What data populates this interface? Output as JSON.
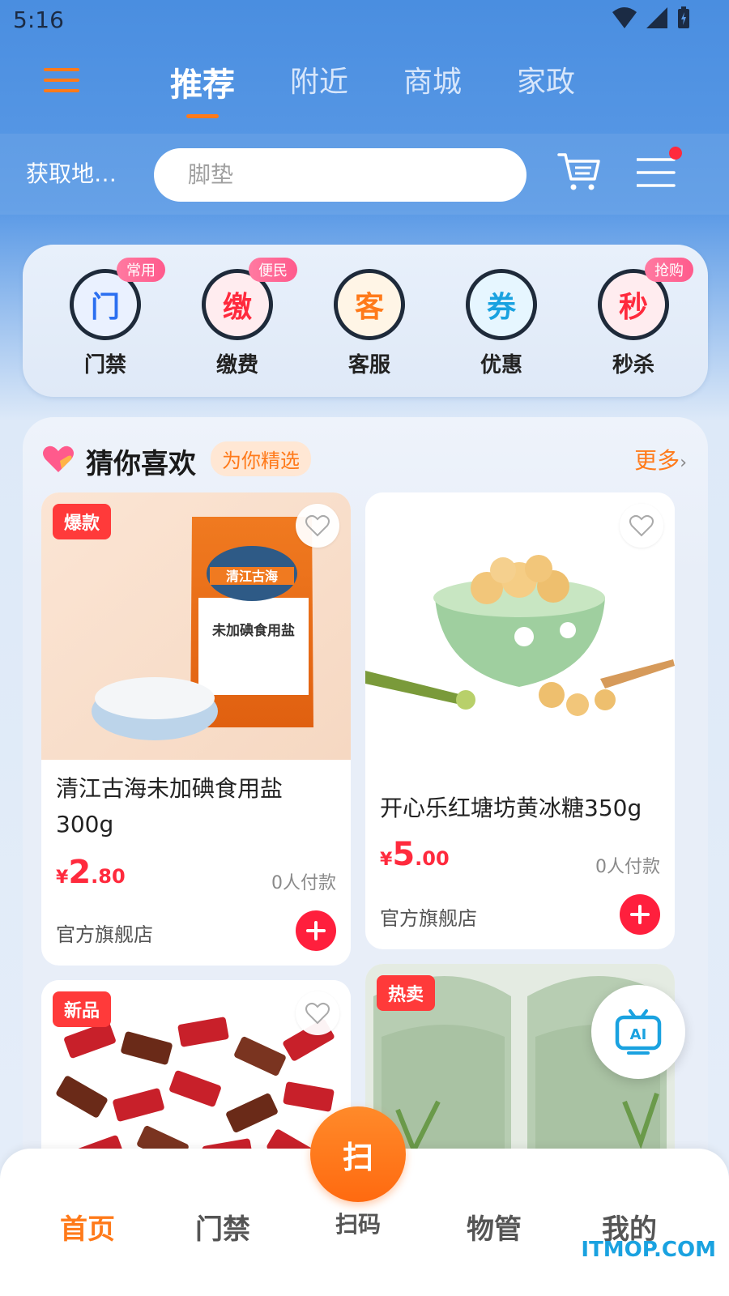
{
  "status": {
    "time": "5:16"
  },
  "top_tabs": [
    {
      "label": "推荐",
      "active": true
    },
    {
      "label": "附近",
      "active": false
    },
    {
      "label": "商城",
      "active": false
    },
    {
      "label": "家政",
      "active": false
    }
  ],
  "search": {
    "location": "获取地…",
    "placeholder": "脚垫"
  },
  "quick_actions": [
    {
      "glyph": "门",
      "label": "门禁",
      "badge": "常用",
      "color": "#2b6ff0",
      "bg": "#eaf1ff"
    },
    {
      "glyph": "缴",
      "label": "缴费",
      "badge": "便民",
      "color": "#ff2a3d",
      "bg": "#ffecef"
    },
    {
      "glyph": "客",
      "label": "客服",
      "badge": "",
      "color": "#ff7a1a",
      "bg": "#fff5e6"
    },
    {
      "glyph": "券",
      "label": "优惠",
      "badge": "",
      "color": "#1aa2e0",
      "bg": "#e6f6ff"
    },
    {
      "glyph": "秒",
      "label": "秒杀",
      "badge": "抢购",
      "color": "#ff2a3d",
      "bg": "#ffecef"
    }
  ],
  "recommend": {
    "title": "猜你喜欢",
    "subtitle": "为你精选",
    "more": "更多"
  },
  "products": [
    {
      "tag": "爆款",
      "name": "清江古海未加碘食用盐300g",
      "price_int": "2",
      "price_dec": ".80",
      "currency": "¥",
      "sold": "0人付款",
      "store": "官方旗舰店"
    },
    {
      "tag": "",
      "name": "开心乐红塘坊黄冰糖350g",
      "price_int": "5",
      "price_dec": ".00",
      "currency": "¥",
      "sold": "0人付款",
      "store": "官方旗舰店"
    },
    {
      "tag": "新品"
    },
    {
      "tag": "热卖"
    }
  ],
  "product_images": {
    "salt_pack_title": "清江古海",
    "salt_pack_text": "未加碘食用盐"
  },
  "ai_button": {
    "label": "AI"
  },
  "bottom_nav": [
    {
      "label": "首页",
      "active": true
    },
    {
      "label": "门禁",
      "active": false
    },
    {
      "label": "扫码",
      "active": false
    },
    {
      "label": "物管",
      "active": false
    },
    {
      "label": "我的",
      "active": false
    }
  ],
  "scan_button": {
    "glyph": "扫"
  },
  "watermark": "ITMOP.COM",
  "colors": {
    "accent": "#ff7a1a",
    "price": "#ff2a3d",
    "header_blue": "#4a8ee0"
  }
}
